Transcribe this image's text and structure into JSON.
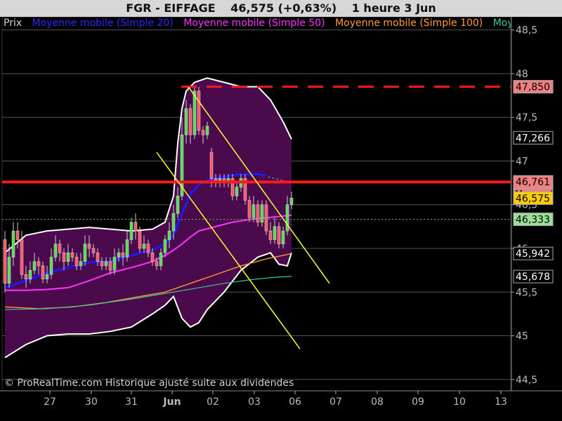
{
  "header": {
    "symbol": "FGR - EIFFAGE",
    "last": "46,575 (+0,63%)",
    "period": "1 heure  3 Jun"
  },
  "legend": [
    {
      "label": "Prix",
      "color": "#d0d0d0"
    },
    {
      "label": "Moyenne mobile (Simple 20)",
      "color": "#2a2aff"
    },
    {
      "label": "Moyenne mobile (Simple 50)",
      "color": "#ff33ff"
    },
    {
      "label": "Moyenne mobile (Simple 100)",
      "color": "#ff9933"
    },
    {
      "label": "Moye",
      "color": "#33cc99"
    }
  ],
  "copyright": "© ProRealTime.com Historique ajusté suite aux dividendes",
  "chart_data": {
    "type": "candlestick",
    "y_ticks": [
      {
        "value": 48.5,
        "label": "48,5"
      },
      {
        "value": 48,
        "label": "48"
      },
      {
        "value": 47.5,
        "label": "47,5"
      },
      {
        "value": 47,
        "label": "47"
      },
      {
        "value": 46.5,
        "label": "46,5"
      },
      {
        "value": 46,
        "label": "46"
      },
      {
        "value": 45.5,
        "label": "45,5"
      },
      {
        "value": 45,
        "label": "45"
      },
      {
        "value": 44.5,
        "label": "44,5"
      }
    ],
    "ylim": [
      44.37,
      48.65
    ],
    "x_ticks": [
      {
        "label": "27",
        "bold": false
      },
      {
        "label": "30",
        "bold": false
      },
      {
        "label": "31",
        "bold": false
      },
      {
        "label": "Jun",
        "bold": true
      },
      {
        "label": "02",
        "bold": false
      },
      {
        "label": "03",
        "bold": false
      },
      {
        "label": "06",
        "bold": false
      },
      {
        "label": "07",
        "bold": false
      },
      {
        "label": "08",
        "bold": false
      },
      {
        "label": "09",
        "bold": false
      },
      {
        "label": "10",
        "bold": false
      },
      {
        "label": "13",
        "bold": false
      }
    ],
    "price_labels": [
      {
        "value": 47.85,
        "label": "47,850",
        "bg": "#f08080",
        "fg": "#000000"
      },
      {
        "value": 47.266,
        "label": "47,266",
        "bg": "#000000",
        "fg": "#ffffff"
      },
      {
        "value": 46.761,
        "label": "46,761",
        "bg": "#f08080",
        "fg": "#000000",
        "sublabel": "Mensuel"
      },
      {
        "value": 46.575,
        "label": "46,575",
        "bg": "#ffcc00",
        "fg": "#000000"
      },
      {
        "value": 46.333,
        "label": "46,333",
        "bg": "#99dd99",
        "fg": "#000000"
      },
      {
        "value": 45.942,
        "label": "45,942",
        "bg": "#000000",
        "fg": "#ffffff"
      },
      {
        "value": 45.678,
        "label": "45,678",
        "bg": "#000000",
        "fg": "#ffffff"
      }
    ],
    "horizontal_levels": [
      {
        "value": 47.85,
        "style": "dashed",
        "color": "#ff1a1a"
      },
      {
        "value": 46.76,
        "style": "solid",
        "color": "#ff1a1a"
      },
      {
        "value": 46.333,
        "style": "dotted",
        "color": "#44cc44"
      }
    ],
    "candles": [
      [
        46.1,
        45.6,
        46.2,
        45.5
      ],
      [
        45.6,
        45.9,
        46.05,
        45.55
      ],
      [
        45.9,
        46.2,
        46.3,
        45.8
      ],
      [
        46.2,
        46.1,
        46.3,
        46.0
      ],
      [
        46.1,
        45.7,
        46.2,
        45.65
      ],
      [
        45.7,
        45.65,
        45.8,
        45.55
      ],
      [
        45.65,
        45.75,
        45.85,
        45.6
      ],
      [
        45.75,
        45.85,
        45.95,
        45.7
      ],
      [
        45.85,
        45.8,
        45.9,
        45.7
      ],
      [
        45.8,
        45.65,
        45.85,
        45.6
      ],
      [
        45.65,
        45.7,
        45.8,
        45.6
      ],
      [
        45.7,
        45.9,
        46.0,
        45.65
      ],
      [
        45.9,
        46.05,
        46.15,
        45.85
      ],
      [
        46.05,
        45.95,
        46.1,
        45.85
      ],
      [
        45.95,
        45.85,
        46.0,
        45.75
      ],
      [
        45.85,
        45.95,
        46.05,
        45.8
      ],
      [
        45.95,
        45.9,
        46.0,
        45.85
      ],
      [
        45.9,
        45.8,
        45.95,
        45.75
      ],
      [
        45.8,
        45.85,
        45.95,
        45.75
      ],
      [
        45.85,
        46.05,
        46.15,
        45.8
      ],
      [
        46.05,
        46.0,
        46.15,
        45.9
      ],
      [
        46.0,
        45.95,
        46.05,
        45.9
      ],
      [
        45.95,
        45.85,
        46.0,
        45.8
      ],
      [
        45.85,
        45.8,
        45.9,
        45.75
      ],
      [
        45.8,
        45.85,
        45.9,
        45.75
      ],
      [
        45.85,
        45.75,
        45.9,
        45.7
      ],
      [
        45.75,
        45.9,
        46.0,
        45.7
      ],
      [
        45.9,
        45.95,
        46.0,
        45.85
      ],
      [
        45.95,
        45.9,
        46.05,
        45.8
      ],
      [
        45.9,
        46.1,
        46.2,
        45.85
      ],
      [
        46.1,
        46.3,
        46.35,
        46.05
      ],
      [
        46.3,
        46.2,
        46.4,
        46.1
      ],
      [
        46.2,
        46.0,
        46.25,
        45.95
      ],
      [
        46.0,
        46.05,
        46.15,
        45.95
      ],
      [
        46.05,
        45.95,
        46.1,
        45.9
      ],
      [
        45.95,
        45.85,
        46.0,
        45.8
      ],
      [
        45.85,
        45.8,
        45.9,
        45.75
      ],
      [
        45.8,
        45.95,
        46.0,
        45.75
      ],
      [
        45.95,
        46.1,
        46.15,
        45.9
      ],
      [
        46.1,
        46.2,
        46.3,
        46.0
      ],
      [
        46.2,
        46.4,
        46.5,
        46.1
      ],
      [
        46.4,
        46.6,
        46.7,
        46.35
      ],
      [
        46.6,
        47.3,
        47.5,
        46.55
      ],
      [
        47.3,
        47.6,
        47.7,
        47.2
      ],
      [
        47.6,
        47.3,
        47.65,
        47.2
      ],
      [
        47.3,
        47.8,
        47.85,
        47.25
      ],
      [
        47.8,
        47.35,
        47.85,
        47.3
      ],
      [
        47.35,
        47.3,
        47.4,
        47.2
      ],
      [
        47.3,
        47.4,
        47.45,
        47.25
      ],
      [
        47.1,
        46.8,
        47.15,
        46.7
      ],
      [
        46.8,
        46.75,
        46.85,
        46.7
      ],
      [
        46.75,
        46.8,
        46.85,
        46.7
      ],
      [
        46.8,
        46.75,
        46.85,
        46.7
      ],
      [
        46.75,
        46.8,
        46.85,
        46.7
      ],
      [
        46.8,
        46.6,
        46.85,
        46.55
      ],
      [
        46.6,
        46.7,
        46.75,
        46.55
      ],
      [
        46.7,
        46.8,
        46.85,
        46.65
      ],
      [
        46.8,
        46.55,
        46.85,
        46.5
      ],
      [
        46.55,
        46.35,
        46.6,
        46.3
      ],
      [
        46.35,
        46.5,
        46.6,
        46.3
      ],
      [
        46.5,
        46.3,
        46.55,
        46.25
      ],
      [
        46.3,
        46.5,
        46.55,
        46.25
      ],
      [
        46.5,
        46.2,
        46.55,
        46.15
      ],
      [
        46.2,
        46.1,
        46.3,
        46.05
      ],
      [
        46.1,
        46.25,
        46.35,
        46.05
      ],
      [
        46.25,
        46.05,
        46.3,
        46.0
      ],
      [
        46.05,
        46.2,
        46.25,
        46.0
      ],
      [
        46.2,
        46.5,
        46.6,
        46.15
      ],
      [
        46.5,
        46.575,
        46.65,
        46.45
      ]
    ],
    "series": [
      {
        "name": "Moyenne mobile (Simple 20)",
        "color": "#1a1aff",
        "width": 3,
        "values": [
          [
            0,
            45.55
          ],
          [
            5,
            45.63
          ],
          [
            10,
            45.72
          ],
          [
            15,
            45.78
          ],
          [
            20,
            45.84
          ],
          [
            25,
            45.85
          ],
          [
            30,
            45.92
          ],
          [
            35,
            45.98
          ],
          [
            38,
            46.05
          ],
          [
            40,
            46.15
          ],
          [
            42,
            46.4
          ],
          [
            44,
            46.62
          ],
          [
            46,
            46.73
          ],
          [
            48,
            46.78
          ],
          [
            52,
            46.82
          ],
          [
            56,
            46.85
          ],
          [
            60,
            46.85
          ],
          [
            62,
            46.83
          ]
        ]
      },
      {
        "name": "Moyenne mobile (Simple 50)",
        "color": "#ff33ff",
        "width": 2,
        "values": [
          [
            0,
            45.52
          ],
          [
            5,
            45.52
          ],
          [
            10,
            45.53
          ],
          [
            15,
            45.55
          ],
          [
            20,
            45.63
          ],
          [
            25,
            45.72
          ],
          [
            30,
            45.78
          ],
          [
            35,
            45.85
          ],
          [
            38,
            45.92
          ],
          [
            40,
            45.98
          ],
          [
            42,
            46.05
          ],
          [
            44,
            46.13
          ],
          [
            46,
            46.2
          ],
          [
            50,
            46.25
          ],
          [
            54,
            46.3
          ],
          [
            58,
            46.33
          ],
          [
            62,
            46.35
          ],
          [
            66,
            46.37
          ],
          [
            68,
            46.38
          ]
        ]
      },
      {
        "name": "Moyenne mobile (Simple 100)",
        "color": "#ff9933",
        "width": 1.4,
        "values": [
          [
            0,
            45.33
          ],
          [
            8,
            45.31
          ],
          [
            16,
            45.33
          ],
          [
            24,
            45.38
          ],
          [
            32,
            45.45
          ],
          [
            38,
            45.5
          ],
          [
            44,
            45.6
          ],
          [
            50,
            45.7
          ],
          [
            56,
            45.8
          ],
          [
            62,
            45.88
          ],
          [
            66,
            45.92
          ],
          [
            68,
            45.94
          ]
        ]
      },
      {
        "name": "Moye",
        "color": "#33cc99",
        "width": 1.2,
        "values": [
          [
            0,
            45.3
          ],
          [
            10,
            45.31
          ],
          [
            20,
            45.35
          ],
          [
            30,
            45.42
          ],
          [
            40,
            45.5
          ],
          [
            46,
            45.55
          ],
          [
            52,
            45.6
          ],
          [
            58,
            45.64
          ],
          [
            64,
            45.67
          ],
          [
            68,
            45.68
          ]
        ]
      }
    ],
    "bollinger": {
      "upper": [
        [
          0,
          45.95
        ],
        [
          5,
          46.15
        ],
        [
          10,
          46.2
        ],
        [
          15,
          46.22
        ],
        [
          20,
          46.24
        ],
        [
          25,
          46.22
        ],
        [
          30,
          46.2
        ],
        [
          35,
          46.22
        ],
        [
          38,
          46.3
        ],
        [
          40,
          46.6
        ],
        [
          41,
          47.2
        ],
        [
          42,
          47.6
        ],
        [
          43,
          47.8
        ],
        [
          45,
          47.9
        ],
        [
          48,
          47.95
        ],
        [
          52,
          47.9
        ],
        [
          56,
          47.85
        ],
        [
          60,
          47.85
        ],
        [
          63,
          47.7
        ],
        [
          66,
          47.45
        ],
        [
          68,
          47.25
        ]
      ],
      "mid": [
        [
          0,
          45.55
        ],
        [
          5,
          45.63
        ],
        [
          10,
          45.72
        ],
        [
          15,
          45.78
        ],
        [
          20,
          45.84
        ],
        [
          25,
          45.85
        ],
        [
          30,
          45.92
        ],
        [
          35,
          45.98
        ],
        [
          38,
          46.05
        ],
        [
          40,
          46.15
        ],
        [
          42,
          46.4
        ],
        [
          44,
          46.62
        ],
        [
          46,
          46.73
        ],
        [
          48,
          46.78
        ],
        [
          52,
          46.82
        ],
        [
          56,
          46.85
        ],
        [
          60,
          46.85
        ],
        [
          64,
          46.8
        ],
        [
          68,
          46.75
        ]
      ],
      "lower": [
        [
          0,
          44.75
        ],
        [
          5,
          44.9
        ],
        [
          10,
          45.0
        ],
        [
          15,
          45.02
        ],
        [
          20,
          45.02
        ],
        [
          25,
          45.05
        ],
        [
          30,
          45.1
        ],
        [
          35,
          45.25
        ],
        [
          38,
          45.35
        ],
        [
          40,
          45.45
        ],
        [
          42,
          45.2
        ],
        [
          44,
          45.1
        ],
        [
          46,
          45.15
        ],
        [
          48,
          45.3
        ],
        [
          52,
          45.5
        ],
        [
          56,
          45.75
        ],
        [
          60,
          45.9
        ],
        [
          63,
          45.95
        ],
        [
          65,
          45.82
        ],
        [
          67,
          45.8
        ],
        [
          68,
          45.95
        ]
      ]
    },
    "trendlines": [
      {
        "color": "#ffff33",
        "from": [
          43.5,
          47.85
        ],
        "to": [
          77,
          45.6
        ]
      },
      {
        "color": "#ffff33",
        "from": [
          36,
          47.1
        ],
        "to": [
          70,
          44.85
        ]
      }
    ]
  }
}
